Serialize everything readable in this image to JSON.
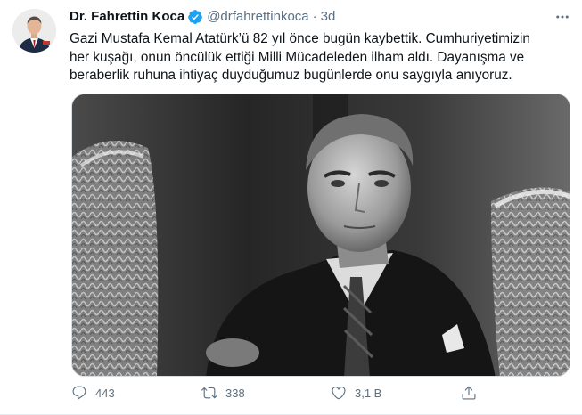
{
  "tweet": {
    "author_name": "Dr. Fahrettin Koca",
    "handle": "@drfahrettinkoca",
    "separator": "·",
    "time": "3d",
    "text": "Gazi Mustafa Kemal Atatürk’ü 82 yıl önce bugün kaybettik. Cumhuriyetimizin\nher kuşağı, onun öncülük ettiği Milli Mücadeleden ilham aldı. Dayanışma ve\nberaberlik ruhuna ihtiyaç duyduğumuz bugünlerde onu saygıyla anıyoruz.",
    "media": {
      "description": "",
      "style": "black-and-white photograph"
    }
  },
  "actions": {
    "reply_count": "443",
    "retweet_count": "338",
    "like_count": "3,1 B",
    "share_label": ""
  },
  "icons": {
    "verified": "verified-badge-icon",
    "more": "more-options-icon",
    "reply": "reply-icon",
    "retweet": "retweet-icon",
    "like": "heart-icon",
    "share": "share-icon"
  },
  "colors": {
    "verified_blue": "#1da1f2",
    "secondary_text": "#5b7083",
    "primary_text": "#0f1419",
    "border": "#e6ecf0"
  }
}
